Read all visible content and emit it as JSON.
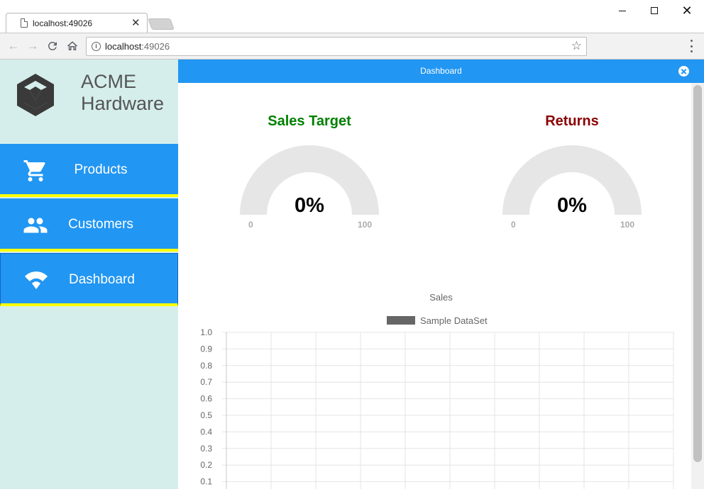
{
  "browser": {
    "tab_title": "localhost:49026",
    "url_host": "localhost",
    "url_port": ":49026"
  },
  "sidebar": {
    "brand_line1": "ACME",
    "brand_line2": "Hardware",
    "items": [
      {
        "label": "Products",
        "icon": "cart-icon"
      },
      {
        "label": "Customers",
        "icon": "people-icon"
      },
      {
        "label": "Dashboard",
        "icon": "gauge-icon",
        "active": true
      }
    ]
  },
  "header": {
    "title": "Dashboard"
  },
  "gauges": {
    "sales": {
      "title": "Sales Target",
      "value": "0%",
      "min": "0",
      "max": "100",
      "color": "#008000",
      "level": 0
    },
    "returns": {
      "title": "Returns",
      "value": "0%",
      "min": "0",
      "max": "100",
      "color": "#8b0000",
      "level": 0
    }
  },
  "colors": {
    "accent": "#2196f3",
    "sidebar_bg": "#d5eeec",
    "nav_underline": "#ffff00"
  },
  "chart_data": {
    "type": "bar",
    "title": "Sales",
    "legend": "top",
    "series": [
      {
        "name": "Sample DataSet",
        "values": []
      }
    ],
    "y_ticks": [
      "1.0",
      "0.9",
      "0.8",
      "0.7",
      "0.6",
      "0.5",
      "0.4",
      "0.3",
      "0.2",
      "0.1"
    ],
    "ylim": [
      0,
      1
    ],
    "grid": true
  }
}
